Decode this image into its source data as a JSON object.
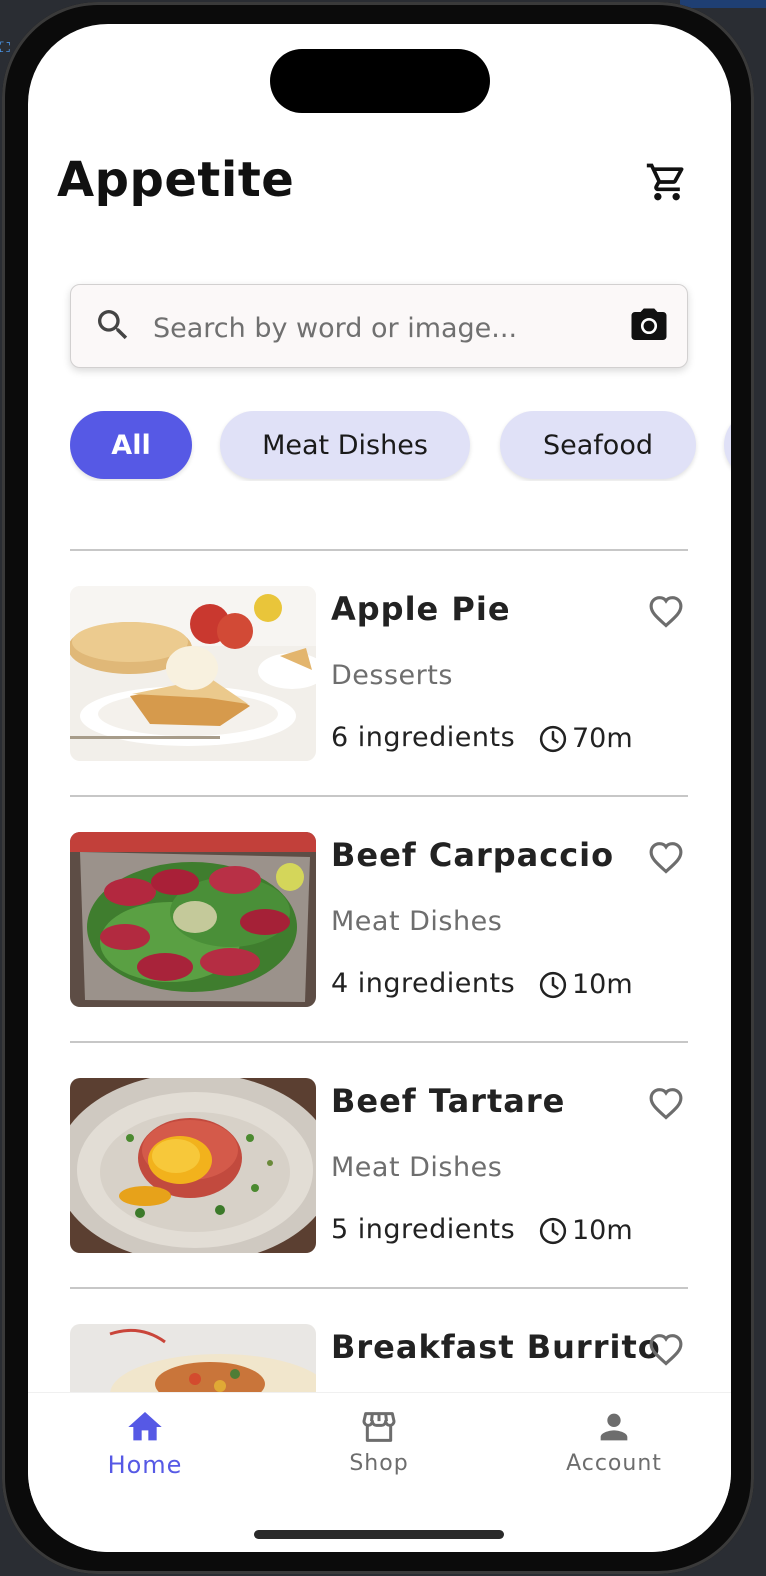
{
  "app": {
    "title": "Appetite"
  },
  "search": {
    "placeholder": "Search by word or image..."
  },
  "chips": [
    {
      "label": "All",
      "active": true
    },
    {
      "label": "Meat Dishes",
      "active": false
    },
    {
      "label": "Seafood",
      "active": false
    }
  ],
  "recipes": [
    {
      "name": "Apple Pie",
      "category": "Desserts",
      "ingredients": "6 ingredients",
      "time": "70m",
      "favorite": false
    },
    {
      "name": "Beef Carpaccio",
      "category": "Meat Dishes",
      "ingredients": "4 ingredients",
      "time": "10m",
      "favorite": false
    },
    {
      "name": "Beef Tartare",
      "category": "Meat Dishes",
      "ingredients": "5 ingredients",
      "time": "10m",
      "favorite": false
    },
    {
      "name": "Breakfast Burrito",
      "favorite": false
    }
  ],
  "nav": {
    "items": [
      {
        "label": "Home",
        "icon": "home-icon",
        "active": true
      },
      {
        "label": "Shop",
        "icon": "storefront-icon",
        "active": false
      },
      {
        "label": "Account",
        "icon": "person-icon",
        "active": false
      }
    ]
  },
  "colors": {
    "accent": "#5659e5",
    "chip_bg": "#e0e1f7",
    "text": "#222222",
    "muted": "#6e6e6e"
  }
}
